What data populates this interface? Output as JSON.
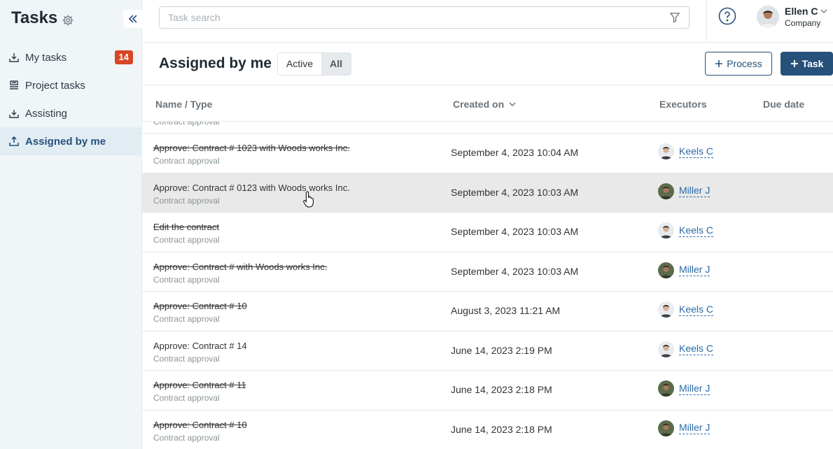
{
  "app": {
    "title": "Tasks"
  },
  "sidebar": {
    "items": [
      {
        "label": "My tasks",
        "badge": "14",
        "icon": "inbox-download-icon"
      },
      {
        "label": "Project tasks",
        "icon": "project-stack-icon"
      },
      {
        "label": "Assisting",
        "icon": "inbox-download-icon"
      },
      {
        "label": "Assigned by me",
        "icon": "inbox-upload-icon",
        "active": true
      }
    ]
  },
  "topbar": {
    "search_placeholder": "Task search",
    "user_name": "Ellen C",
    "user_company": "Company"
  },
  "header": {
    "title": "Assigned by me",
    "filters": [
      "Active",
      "All"
    ],
    "selected_filter": "All",
    "process_label": "Process",
    "task_label": "Task"
  },
  "table": {
    "columns": [
      "Name / Type",
      "Created on",
      "Executors",
      "Due date"
    ],
    "partial_row_type": "Contract approval",
    "rows": [
      {
        "name": "Approve: Contract # 1023 with Woods works Inc.",
        "type": "Contract approval",
        "created": "September 4, 2023 10:04 AM",
        "executor": "Keels C",
        "done": true
      },
      {
        "name": "Approve: Contract # 0123 with Woods works Inc.",
        "type": "Contract approval",
        "created": "September 4, 2023 10:03 AM",
        "executor": "Miller J",
        "done": false
      },
      {
        "name": "Edit the contract",
        "type": "Contract approval",
        "created": "September 4, 2023 10:03 AM",
        "executor": "Keels C",
        "done": true
      },
      {
        "name": "Approve: Contract # with Woods works Inc.",
        "type": "Contract approval",
        "created": "September 4, 2023 10:03 AM",
        "executor": "Miller J",
        "done": true
      },
      {
        "name": "Approve: Contract # 10",
        "type": "Contract approval",
        "created": "August 3, 2023 11:21 AM",
        "executor": "Keels C",
        "done": true
      },
      {
        "name": "Approve: Contract # 14",
        "type": "Contract approval",
        "created": "June 14, 2023 2:19 PM",
        "executor": "Keels C",
        "done": false
      },
      {
        "name": "Approve: Contract # 11",
        "type": "Contract approval",
        "created": "June 14, 2023 2:18 PM",
        "executor": "Miller J",
        "done": true
      },
      {
        "name": "Approve: Contract # 10",
        "type": "Contract approval",
        "created": "June 14, 2023 2:18 PM",
        "executor": "Miller J",
        "done": true
      }
    ]
  },
  "colors": {
    "accent": "#27517a",
    "badge": "#d74726",
    "link": "#2a6aa8"
  }
}
